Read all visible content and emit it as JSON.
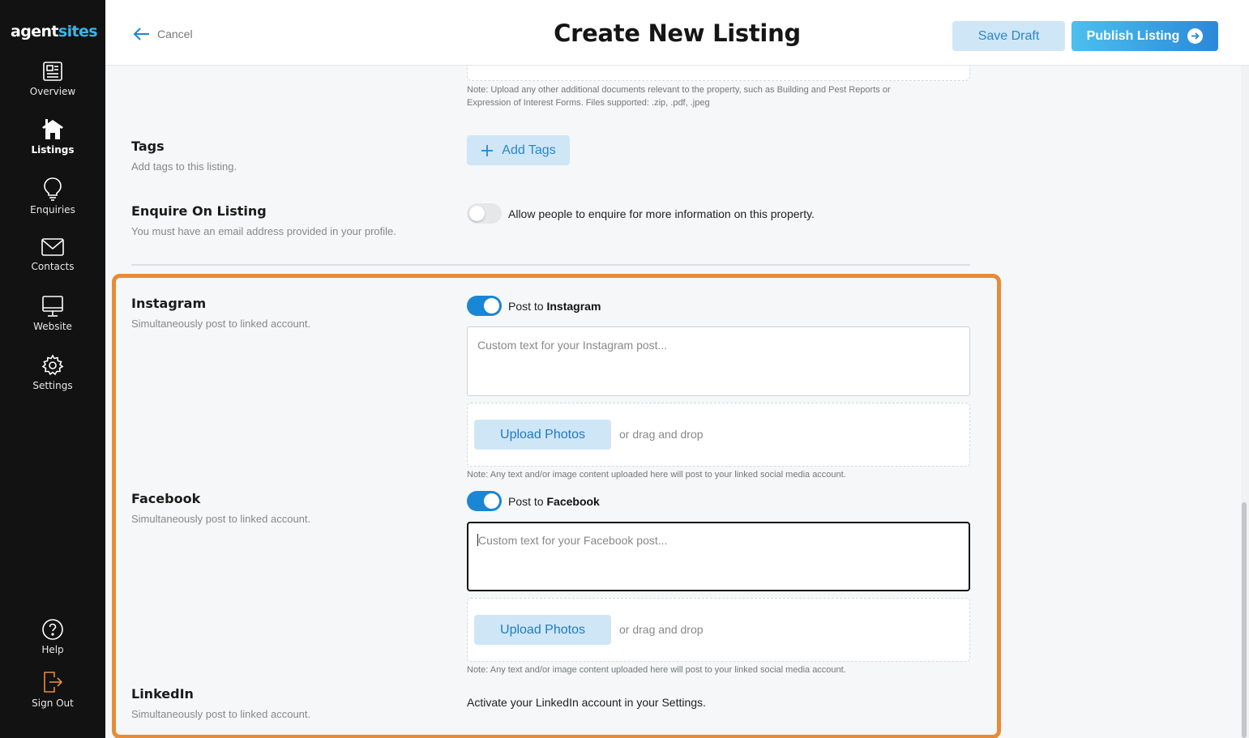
{
  "app": {
    "logo_part1": "agent",
    "logo_part2": "sites"
  },
  "sidebar": {
    "items": [
      {
        "label": "Overview",
        "icon": "overview-icon"
      },
      {
        "label": "Listings",
        "icon": "listings-icon",
        "active": true
      },
      {
        "label": "Enquiries",
        "icon": "lightbulb-icon"
      },
      {
        "label": "Contacts",
        "icon": "envelope-icon"
      },
      {
        "label": "Website",
        "icon": "monitor-icon"
      },
      {
        "label": "Settings",
        "icon": "gear-icon"
      }
    ],
    "bottom": [
      {
        "label": "Help",
        "icon": "help-icon"
      },
      {
        "label": "Sign Out",
        "icon": "sign-out-icon"
      }
    ]
  },
  "header": {
    "cancel_label": "Cancel",
    "title": "Create New Listing",
    "save_draft_label": "Save Draft",
    "publish_label": "Publish Listing"
  },
  "documents": {
    "note_line1": "Note: Upload any other additional documents relevant to the property, such as Building and Pest Reports or",
    "note_line2": "Expression of Interest Forms. Files supported: .zip, .pdf, .jpeg"
  },
  "tags": {
    "title": "Tags",
    "subtitle": "Add tags to this listing.",
    "button_label": "Add Tags"
  },
  "enquire": {
    "title": "Enquire On Listing",
    "subtitle": "You must have an email address provided in your profile.",
    "toggle_text": "Allow people to enquire for more information on this property.",
    "enabled": false
  },
  "instagram": {
    "title": "Instagram",
    "subtitle": "Simultaneously post to linked account.",
    "toggle_prefix": "Post to",
    "toggle_target": "Instagram",
    "enabled": true,
    "placeholder": "Custom text for your Instagram post...",
    "upload_label": "Upload Photos",
    "drag_text": "or drag and drop",
    "note": "Note: Any text and/or image content uploaded here will post to your linked social media account."
  },
  "facebook": {
    "title": "Facebook",
    "subtitle": "Simultaneously post to linked account.",
    "toggle_prefix": "Post to",
    "toggle_target": "Facebook",
    "enabled": true,
    "placeholder": "Custom text for your Facebook post...",
    "upload_label": "Upload Photos",
    "drag_text": "or drag and drop",
    "note": "Note: Any text and/or image content uploaded here will post to your linked social media account."
  },
  "linkedin": {
    "title": "LinkedIn",
    "subtitle": "Simultaneously post to linked account.",
    "activate_text": "Activate your LinkedIn account in your Settings."
  },
  "colors": {
    "sidebar_bg": "#121212",
    "accent": "#1a86d6",
    "highlight": "#e88b36",
    "light_button": "#cfe6f7"
  }
}
